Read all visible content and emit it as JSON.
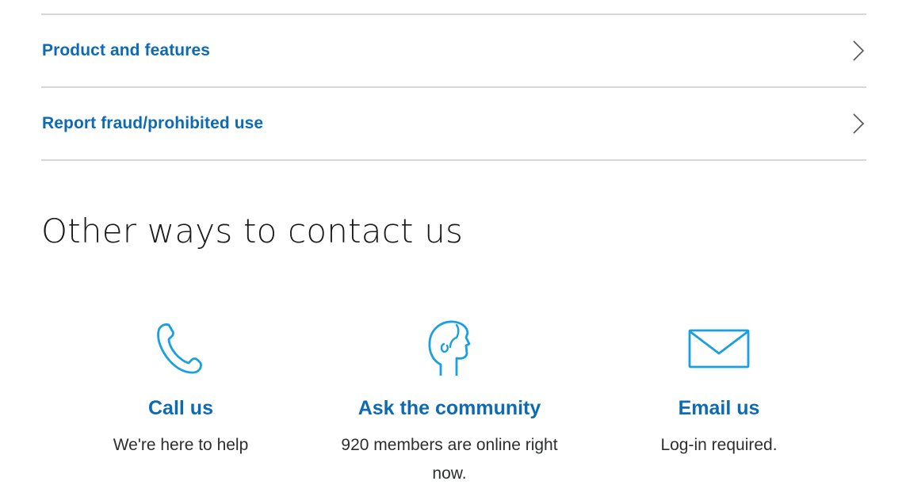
{
  "accordion": {
    "items": [
      {
        "label": "Product and features"
      },
      {
        "label": "Report fraud/prohibited use"
      }
    ]
  },
  "contact": {
    "heading": "Other ways to contact us",
    "options": [
      {
        "title": "Call us",
        "description": "We're here to help",
        "icon": "phone-icon"
      },
      {
        "title": "Ask the community",
        "description": "920 members are online right now.",
        "icon": "community-head-icon"
      },
      {
        "title": "Email us",
        "description": "Log-in required.",
        "icon": "envelope-icon"
      }
    ]
  },
  "colors": {
    "link": "#0e6bb3",
    "icon": "#1aa0e0",
    "divider": "#d6d6d6",
    "heading": "#1b1b1b"
  }
}
